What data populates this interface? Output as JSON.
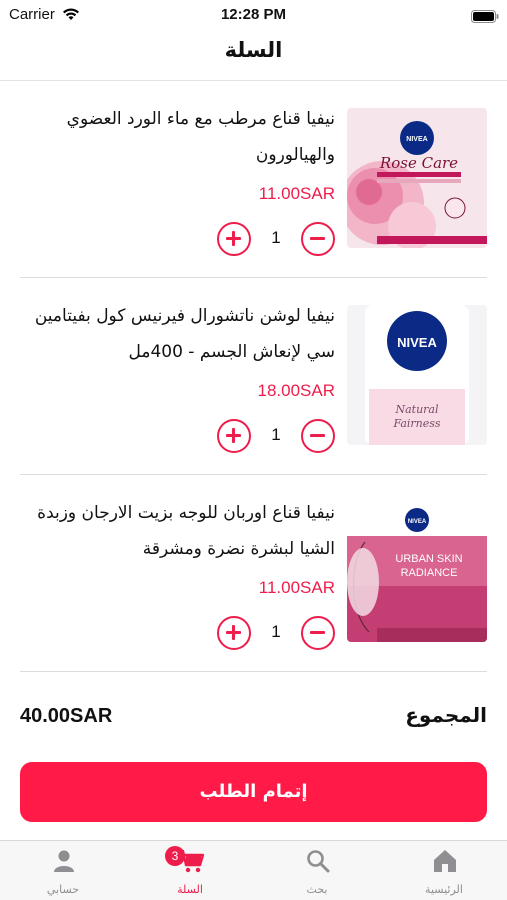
{
  "status_bar": {
    "carrier": "Carrier",
    "time": "12:28 PM"
  },
  "header": {
    "title": "السلة"
  },
  "cart": {
    "items": [
      {
        "name": "نيفيا قناع مرطب مع ماء الورد العضوي والهيالورون",
        "price": "11.00SAR",
        "quantity": "1",
        "image_icon": "rose-care-sheet-mask-image",
        "image_text": "Rose Care"
      },
      {
        "name": "نيفيا لوشن ناتشورال فيرنيس كول بفيتامين سي لإنعاش الجسم - 400مل",
        "price": "18.00SAR",
        "quantity": "1",
        "image_icon": "natural-fairness-lotion-image",
        "image_text": "Natural Fairness"
      },
      {
        "name": "نيفيا قناع اوربان للوجه بزيت الارجان وزبدة الشيا لبشرة نضرة ومشرقة",
        "price": "11.00SAR",
        "quantity": "1",
        "image_icon": "urban-skin-radiance-mask-image",
        "image_text": "URBAN SKIN RADIANCE"
      }
    ]
  },
  "summary": {
    "total_label": "المجموع",
    "total_value": "40.00SAR"
  },
  "checkout": {
    "label": "إتمام الطلب"
  },
  "tab_bar": {
    "tabs": [
      {
        "label": "الرئيسية",
        "icon": "home-icon"
      },
      {
        "label": "بحث",
        "icon": "search-icon"
      },
      {
        "label": "السلة",
        "icon": "cart-icon",
        "badge": "3"
      },
      {
        "label": "حسابي",
        "icon": "user-icon"
      }
    ]
  },
  "colors": {
    "accent": "#ee1d4b",
    "nivea_blue": "#0b2a85"
  }
}
